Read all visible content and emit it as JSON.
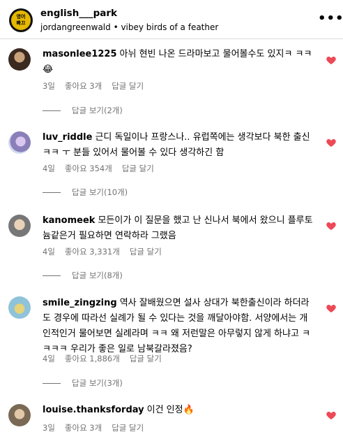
{
  "header": {
    "badge_line1": "영어",
    "badge_line2": "빠끄",
    "account": "english___park",
    "subtitle": "jordangreenwald • vibey birds of a feather",
    "more_icon": "more-horizontal-icon"
  },
  "comments": [
    {
      "username": "masonlee1225",
      "text": "아뉘 현빈 나온 드라마보고 물어볼수도 있지ㅋ ㅋㅋ😂",
      "time": "3일",
      "likes": "좋아요 3개",
      "reply": "답글 달기",
      "view_replies": "답글 보기(2개)"
    },
    {
      "username": "luv_riddle",
      "text": "근디 독일이나 프랑스나.. 유럽쪽에는 생각보다 북한 출신 ㅋㅋ ㅜ 분들 있어서 물어볼 수 있다 생각하긴 함",
      "time": "4일",
      "likes": "좋아요 354개",
      "reply": "답글 달기",
      "view_replies": "답글 보기(10개)"
    },
    {
      "username": "kanomeek",
      "text": "모든이가 이 질문을 했고 난 신나서 북에서 왔으니 플루토늄같은거 필요하면 연락하라 그랬음",
      "time": "4일",
      "likes": "좋아요 3,331개",
      "reply": "답글 달기",
      "view_replies": "답글 보기(8개)"
    },
    {
      "username": "smile_zingzing",
      "text": "역사 잘배웠으면 설사 상대가 북한출신이라 하더라도 경우에 따라선 실례가 될 수 있다는 것을 깨달아야함. 서양에서는 개인적인거 물어보면 실례라며 ㅋㅋ 왜 저런말은 아무렇지 않게 하냐고 ㅋㅋㅋㅋ 우리가 좋은 일로 남북갈라졌음?",
      "time": "4일",
      "likes": "좋아요 1,886개",
      "reply": "답글 달기",
      "view_replies": "답글 보기(3개)"
    },
    {
      "username": "louise.thanksforday",
      "text": "이건 인정🔥",
      "time": "3일",
      "likes": "좋아요 3개",
      "reply": "답글 달기",
      "view_replies": ""
    }
  ],
  "colors": {
    "heart": "#ed4956",
    "meta": "#737373"
  }
}
